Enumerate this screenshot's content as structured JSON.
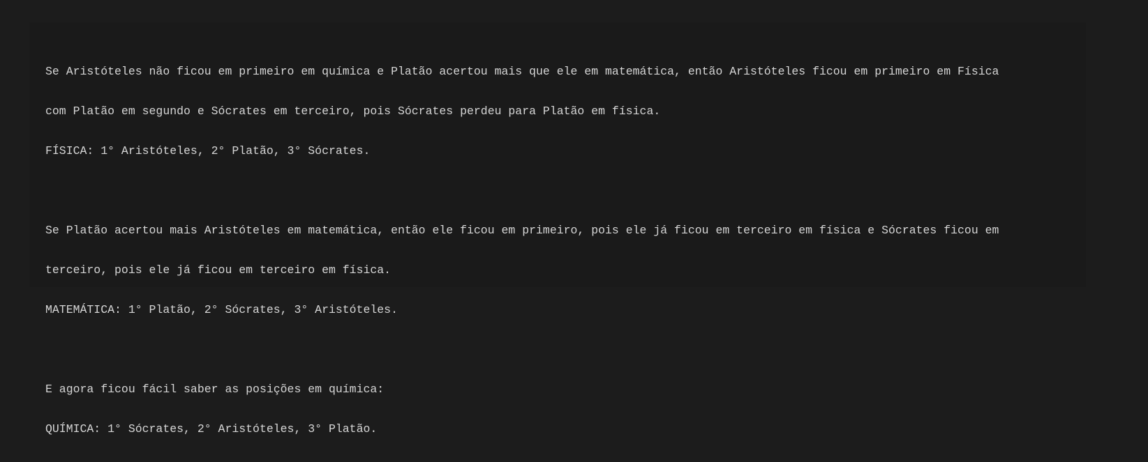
{
  "content": {
    "lines": [
      "Se Aristóteles não ficou em primeiro em química e Platão acertou mais que ele em matemática, então Aristóteles ficou em primeiro em Física",
      "com Platão em segundo e Sócrates em terceiro, pois Sócrates perdeu para Platão em física.",
      "FÍSICA: 1° Aristóteles, 2° Platão, 3° Sócrates.",
      "",
      "Se Platão acertou mais Aristóteles em matemática, então ele ficou em primeiro, pois ele já ficou em terceiro em física e Sócrates ficou em",
      "terceiro, pois ele já ficou em terceiro em física.",
      "MATEMÁTICA: 1° Platão, 2° Sócrates, 3° Aristóteles.",
      "",
      "E agora ficou fácil saber as posições em química:",
      "QUÍMICA: 1° Sócrates, 2° Aristóteles, 3° Platão."
    ]
  }
}
